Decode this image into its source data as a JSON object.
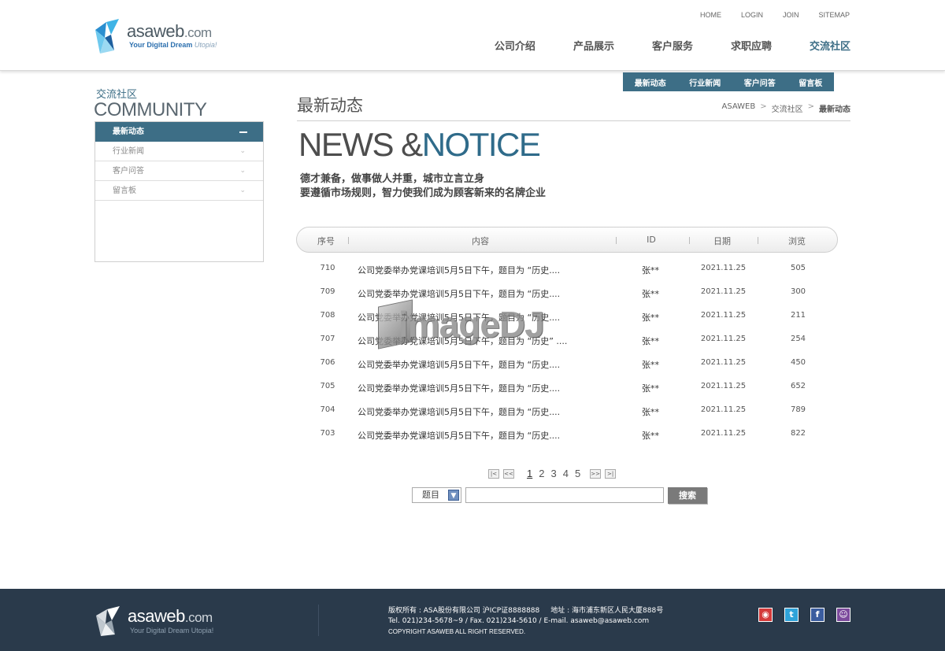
{
  "header": {
    "logo_text": "asaweb",
    "logo_domain": ".com",
    "logo_tagline": "Your Digital Dream",
    "logo_tagline2": "Utopia!",
    "top_links": [
      "HOME",
      "LOGIN",
      "JOIN",
      "SITEMAP"
    ],
    "nav": [
      "公司介绍",
      "产品展示",
      "客户服务",
      "求职应聘",
      "交流社区"
    ],
    "nav_active_index": 4
  },
  "sidebar": {
    "title_cn": "交流社区",
    "title_en": "COMMUNITY",
    "items": [
      {
        "label": "最新动态",
        "active": true
      },
      {
        "label": "行业新闻",
        "active": false
      },
      {
        "label": "客户问答",
        "active": false
      },
      {
        "label": "留言板",
        "active": false
      }
    ]
  },
  "sub_tabs": [
    "最新动态",
    "行业新闻",
    "客户问答",
    "留言板"
  ],
  "main": {
    "title": "最新动态",
    "breadcrumb": [
      "ASAWEB",
      "交流社区",
      "最新动态"
    ],
    "banner_a": "NEWS &",
    "banner_b": "NOTICE",
    "slogan_line1": "德才兼备，做事做人并重，城市立言立身",
    "slogan_line2": "要遵循市场规则，智力使我们成为顾客新来的名牌企业"
  },
  "table": {
    "headers": [
      "序号",
      "内容",
      "ID",
      "日期",
      "浏览"
    ],
    "rows": [
      {
        "num": "710",
        "title": "公司党委举办党课培训5月5日下午，题目为 “历史....",
        "id": "张**",
        "date": "2021.11.25",
        "views": "505"
      },
      {
        "num": "709",
        "title": "公司党委举办党课培训5月5日下午，题目为 “历史....",
        "id": "张**",
        "date": "2021.11.25",
        "views": "300"
      },
      {
        "num": "708",
        "title": "公司党委举办党课培训5月5日下午，题目为 “历史....",
        "id": "张**",
        "date": "2021.11.25",
        "views": "211"
      },
      {
        "num": "707",
        "title": "公司党委举办党课培训5月5日下午，题目为 “历史” ....",
        "id": "张**",
        "date": "2021.11.25",
        "views": "254"
      },
      {
        "num": "706",
        "title": "公司党委举办党课培训5月5日下午，题目为 “历史....",
        "id": "张**",
        "date": "2021.11.25",
        "views": "450"
      },
      {
        "num": "705",
        "title": "公司党委举办党课培训5月5日下午，题目为 “历史....",
        "id": "张**",
        "date": "2021.11.25",
        "views": "652"
      },
      {
        "num": "704",
        "title": "公司党委举办党课培训5月5日下午，题目为 “历史....",
        "id": "张**",
        "date": "2021.11.25",
        "views": "789"
      },
      {
        "num": "703",
        "title": "公司党委举办党课培训5月5日下午，题目为 “历史....",
        "id": "张**",
        "date": "2021.11.25",
        "views": "822"
      }
    ]
  },
  "pagination": {
    "pages": [
      "1",
      "2",
      "3",
      "4",
      "5"
    ],
    "current": "1",
    "first_icon": "first-page-icon",
    "prev_icon": "prev-page-icon",
    "next_icon": "next-page-icon",
    "last_icon": "last-page-icon"
  },
  "search": {
    "select_value": "题目",
    "input_value": "",
    "button_label": "搜索"
  },
  "watermark": "imageDJ",
  "footer": {
    "logo_text": "asaweb",
    "logo_domain": ".com",
    "logo_tagline": "Your Digital Dream Utopia!",
    "line1_a": "版权所有 : ASA股份有限公司 沪ICP证8888888",
    "line1_b": "地址 : 海市浦东新区人民大厦888号",
    "line2": "Tel. 021)234-5678~9  / Fax. 021)234-5610  / E-mail. asaweb@asaweb.com",
    "line3": "COPYRIGHT ASAWEB ALL RIGHT RESERVED.",
    "social": [
      {
        "icon": "weibo-icon",
        "glyph": "◉",
        "color": "#d43a3a"
      },
      {
        "icon": "twitter-icon",
        "glyph": "t",
        "color": "#2fa3d9"
      },
      {
        "icon": "facebook-icon",
        "glyph": "f",
        "color": "#3b5d9f"
      },
      {
        "icon": "chat-icon",
        "glyph": "☺",
        "color": "#7c4a9c"
      }
    ]
  },
  "colors": {
    "accent": "#3d6e86",
    "footer_bg": "#2a3a4b"
  }
}
